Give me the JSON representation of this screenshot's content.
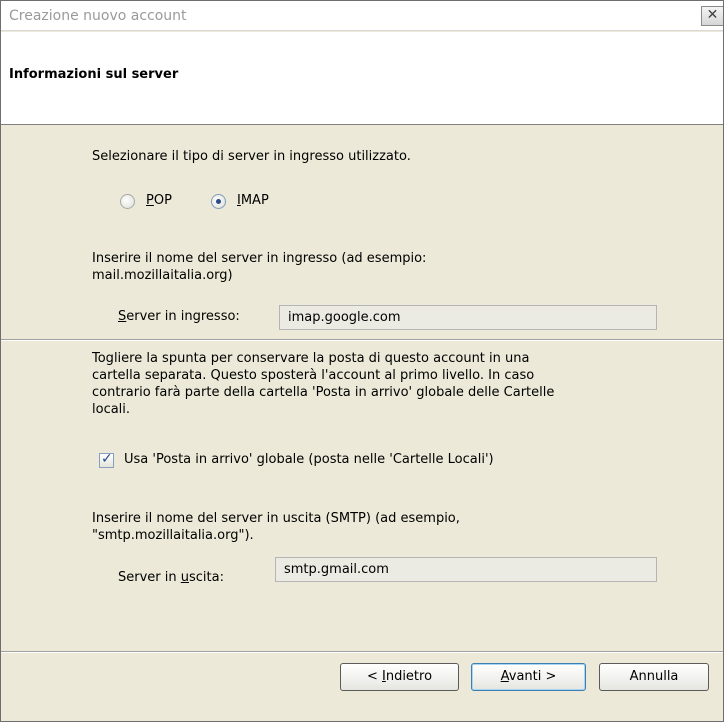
{
  "window": {
    "title": "Creazione nuovo account",
    "close_glyph": "✕"
  },
  "header": {
    "title": "Informazioni sul server"
  },
  "incoming": {
    "type_prompt": "Selezionare il tipo di server in ingresso utilizzato.",
    "options": [
      {
        "pre": "",
        "key": "P",
        "post": "OP",
        "selected": false
      },
      {
        "pre": "",
        "key": "I",
        "post": "MAP",
        "selected": true
      }
    ],
    "server_prompt_line1": "Inserire il nome del server in ingresso (ad esempio:",
    "server_prompt_line2": "mail.mozillaitalia.org)",
    "server_label_key": "S",
    "server_label_rest": "erver in ingresso:",
    "server_value": "imap.google.com"
  },
  "global_inbox": {
    "para_line1": "Togliere la spunta per conservare la posta di questo account in una",
    "para_line2": "cartella separata. Questo sposterà l'account al primo livello. In caso",
    "para_line3": "contrario farà parte della cartella 'Posta in arrivo' globale delle Cartelle",
    "para_line4": "locali.",
    "checkbox_label": "Usa 'Posta in arrivo' globale (posta nelle 'Cartelle Locali')",
    "checked": true
  },
  "outgoing": {
    "prompt_line1": "Inserire il nome del server in uscita (SMTP) (ad esempio,",
    "prompt_line2": "\"smtp.mozillaitalia.org\").",
    "label_pre": "Server in ",
    "label_key": "u",
    "label_post": "scita:",
    "value": "smtp.gmail.com"
  },
  "buttons": {
    "back_pre": "< ",
    "back_key": "I",
    "back_post": "ndietro",
    "next_key": "A",
    "next_post": "vanti >",
    "cancel": "Annulla"
  }
}
